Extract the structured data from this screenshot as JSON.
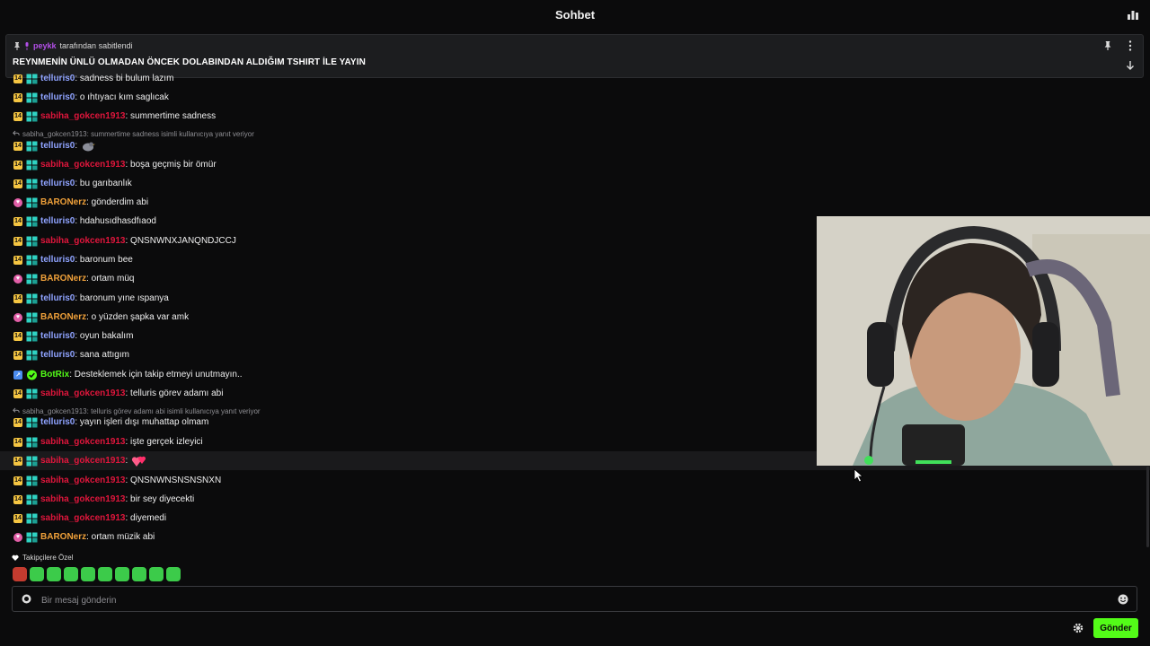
{
  "header": {
    "title": "Sohbet"
  },
  "pinned": {
    "by_user": "peykk",
    "by_text": "tarafından sabitlendi",
    "message": "REYNMENİN ÜNLÜ OLMADAN ÖNCEK DOLABINDAN ALDIĞIM TSHIRT İLE YAYIN"
  },
  "colors": {
    "accent": "#53fc18",
    "telluris": "#8fa3ff",
    "sabiha": "#e0163c",
    "baron": "#f0a13a",
    "botrix": "#53fc18"
  },
  "messages": [
    {
      "user": "telluris0",
      "text": ": sadness bi bulum lazım",
      "badge": "sub",
      "color": "#8fa3ff"
    },
    {
      "user": "telluris0",
      "text": ": o ıhtıyacı kım saglıcak",
      "badge": "sub",
      "color": "#8fa3ff"
    },
    {
      "user": "sabiha_gokcen1913",
      "text": ": summertime sadness",
      "badge": "sub",
      "color": "#e0163c"
    },
    {
      "user": "telluris0",
      "text": ":",
      "badge": "sub",
      "color": "#8fa3ff"
    },
    {
      "user": "sabiha_gokcen1913",
      "text": ": boşa geçmiş bir ömür",
      "badge": "sub",
      "color": "#e0163c"
    },
    {
      "user": "telluris0",
      "text": ": bu garıbanlık",
      "badge": "sub",
      "color": "#8fa3ff"
    },
    {
      "user": "BARONerz",
      "text": ": gönderdim abi",
      "badge": "gift",
      "color": "#f0a13a"
    },
    {
      "user": "telluris0",
      "text": ": hdahusıdhasdfıaod",
      "badge": "sub",
      "color": "#8fa3ff"
    },
    {
      "user": "sabiha_gokcen1913",
      "text": ": QNSNWNXJANQNDJCCJ",
      "badge": "sub",
      "color": "#e0163c"
    },
    {
      "user": "telluris0",
      "text": ": baronum bee",
      "badge": "sub",
      "color": "#8fa3ff"
    },
    {
      "user": "BARONerz",
      "text": ": ortam müq",
      "badge": "gift",
      "color": "#f0a13a"
    },
    {
      "user": "telluris0",
      "text": ": baronum yıne ıspanya",
      "badge": "sub",
      "color": "#8fa3ff"
    },
    {
      "user": "BARONerz",
      "text": ": o yüzden şapka var amk",
      "badge": "gift",
      "color": "#f0a13a"
    },
    {
      "user": "telluris0",
      "text": ": oyun bakalım",
      "badge": "sub",
      "color": "#8fa3ff"
    },
    {
      "user": "telluris0",
      "text": ": sana attıgım",
      "badge": "sub",
      "color": "#8fa3ff"
    },
    {
      "user": "BotRix",
      "text": ": Desteklemek için takip etmeyi unutmayın..",
      "badge": "bot",
      "color": "#53fc18"
    },
    {
      "user": "sabiha_gokcen1913",
      "text": ": telluris görev adamı abi",
      "badge": "sub",
      "color": "#e0163c"
    },
    {
      "user": "telluris0",
      "text": ": yayın işleri dışı muhattap olmam",
      "badge": "sub",
      "color": "#8fa3ff"
    },
    {
      "user": "sabiha_gokcen1913",
      "text": ": işte gerçek izleyici",
      "badge": "sub",
      "color": "#e0163c"
    },
    {
      "user": "sabiha_gokcen1913",
      "text": ":",
      "badge": "sub",
      "color": "#e0163c"
    },
    {
      "user": "sabiha_gokcen1913",
      "text": ": QNSNWNSNSNSNXN",
      "badge": "sub",
      "color": "#e0163c"
    },
    {
      "user": "sabiha_gokcen1913",
      "text": ": bir sey diyecekti",
      "badge": "sub",
      "color": "#e0163c"
    },
    {
      "user": "sabiha_gokcen1913",
      "text": ": diyemedi",
      "badge": "sub",
      "color": "#e0163c"
    },
    {
      "user": "BARONerz",
      "text": ": ortam müzik abi",
      "badge": "gift",
      "color": "#f0a13a"
    }
  ],
  "replies": [
    {
      "text": "sabiha_gokcen1913: summertime sadness isimli kullanıcıya yanıt veriyor"
    },
    {
      "text": "sabiha_gokcen1913: telluris görev adamı abi isimli kullanıcıya yanıt veriyor"
    }
  ],
  "badge_labels": {
    "sub": "14",
    "gift": "♥",
    "bot": "↗"
  },
  "emotes": {
    "label": "Takipçilere Özel"
  },
  "composer": {
    "placeholder": "Bir mesaj gönderin",
    "send_label": "Gönder"
  }
}
